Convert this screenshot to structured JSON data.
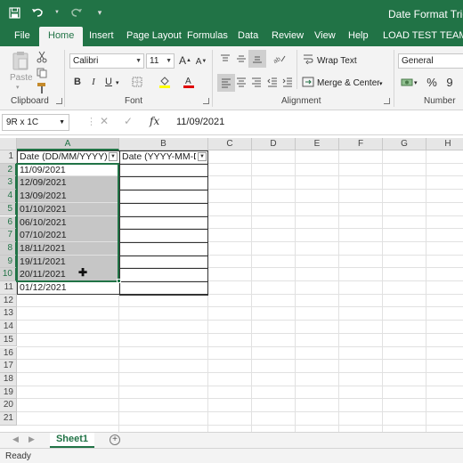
{
  "title": "Date Format Trick",
  "qat": {
    "save_icon": "save-icon",
    "undo_icon": "undo-icon",
    "redo_icon": "redo-icon",
    "customize_icon": "customize-icon"
  },
  "tabs": [
    "File",
    "Home",
    "Insert",
    "Page Layout",
    "Formulas",
    "Data",
    "Review",
    "View",
    "Help",
    "LOAD TEST",
    "TEAM"
  ],
  "active_tab": "Home",
  "ribbon": {
    "clipboard": {
      "label": "Clipboard",
      "paste": "Paste"
    },
    "font": {
      "label": "Font",
      "name": "Calibri",
      "size": "11",
      "grow": "A",
      "shrink": "A",
      "bold": "B",
      "italic": "I",
      "underline": "U"
    },
    "alignment": {
      "label": "Alignment",
      "wrap_text": "Wrap Text",
      "merge_center": "Merge & Center"
    },
    "number": {
      "label": "Number",
      "format": "General",
      "percent": "%",
      "comma": "9"
    }
  },
  "formula_bar": {
    "name_box": "9R x 1C",
    "fx": "fx",
    "cancel": "✕",
    "enter": "✓",
    "value": "11/09/2021"
  },
  "columns": [
    "A",
    "B",
    "C",
    "D",
    "E",
    "F",
    "G",
    "H"
  ],
  "rows": [
    "1",
    "2",
    "3",
    "4",
    "5",
    "6",
    "7",
    "8",
    "9",
    "10",
    "11",
    "12",
    "13",
    "14",
    "15",
    "16",
    "17",
    "18",
    "19",
    "20",
    "21"
  ],
  "table": {
    "headers": [
      "Date (DD/MM/YYYY)",
      "Date (YYYY-MM-DD)"
    ],
    "col_a": [
      "11/09/2021",
      "12/09/2021",
      "13/09/2021",
      "01/10/2021",
      "06/10/2021",
      "07/10/2021",
      "18/11/2021",
      "19/11/2021",
      "20/11/2021",
      "01/12/2021"
    ]
  },
  "sheets": {
    "active": "Sheet1",
    "add": "+"
  },
  "status": "Ready",
  "colors": {
    "brand": "#217346",
    "selection": "#c6c6c6"
  }
}
